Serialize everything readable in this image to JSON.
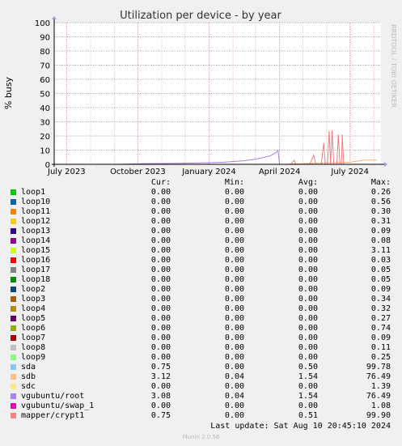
{
  "chart_data": {
    "type": "line",
    "title": "Utilization per device - by year",
    "ylabel": "% busy",
    "ylim": [
      0,
      100
    ],
    "yticks": [
      0,
      10,
      20,
      30,
      40,
      50,
      60,
      70,
      80,
      90,
      100
    ],
    "x_tick_labels": [
      "July 2023",
      "October 2023",
      "January 2024",
      "April 2024",
      "July 2024"
    ],
    "x_range": [
      "2023-06-15",
      "2024-08-10"
    ],
    "x_ticks": [
      "2023-07-01",
      "2023-10-01",
      "2024-01-01",
      "2024-04-01",
      "2024-07-01"
    ],
    "grid": true,
    "series": [
      {
        "name": "vgubuntu/root",
        "color": "#a680e6",
        "points": [
          [
            "2023-09-05",
            0
          ],
          [
            "2023-10-10",
            0.5
          ],
          [
            "2023-11-15",
            0.6
          ],
          [
            "2023-12-20",
            1.0
          ],
          [
            "2024-01-20",
            1.5
          ],
          [
            "2024-02-15",
            2.5
          ],
          [
            "2024-03-05",
            4.0
          ],
          [
            "2024-03-20",
            6.0
          ],
          [
            "2024-03-28",
            8.5
          ],
          [
            "2024-03-30",
            10.0
          ],
          [
            "2024-04-01",
            0
          ]
        ]
      },
      {
        "name": "sdb",
        "color": "#ffb077",
        "points": [
          [
            "2024-04-10",
            0
          ],
          [
            "2024-05-01",
            0.5
          ],
          [
            "2024-06-01",
            1.0
          ],
          [
            "2024-07-01",
            1.5
          ],
          [
            "2024-07-20",
            3.0
          ],
          [
            "2024-08-05",
            3.0
          ]
        ]
      },
      {
        "name": "mapper/crypt1",
        "color": "#f08080",
        "points": [
          [
            "2024-04-15",
            0
          ],
          [
            "2024-04-20",
            3.0
          ],
          [
            "2024-04-22",
            0
          ],
          [
            "2024-05-10",
            0
          ],
          [
            "2024-05-15",
            6.5
          ],
          [
            "2024-05-18",
            0
          ],
          [
            "2024-05-25",
            0
          ],
          [
            "2024-05-28",
            15
          ],
          [
            "2024-05-30",
            0
          ],
          [
            "2024-06-02",
            0
          ],
          [
            "2024-06-04",
            23.5
          ],
          [
            "2024-06-06",
            0
          ],
          [
            "2024-06-08",
            24
          ],
          [
            "2024-06-10",
            0
          ],
          [
            "2024-06-14",
            0
          ],
          [
            "2024-06-16",
            21
          ],
          [
            "2024-06-18",
            0
          ],
          [
            "2024-06-20",
            0
          ],
          [
            "2024-06-21",
            21
          ],
          [
            "2024-06-23",
            0
          ],
          [
            "2024-08-09",
            0
          ]
        ]
      }
    ]
  },
  "side_label": "RRDTOOL / TOBI OETIKER",
  "legend_headers": {
    "cur": "Cur:",
    "min": "Min:",
    "avg": "Avg:",
    "max": "Max:"
  },
  "legend": [
    {
      "name": "loop1",
      "color": "#00cc00",
      "cur": "0.00",
      "min": "0.00",
      "avg": "0.00",
      "max": "0.26"
    },
    {
      "name": "loop10",
      "color": "#0066b3",
      "cur": "0.00",
      "min": "0.00",
      "avg": "0.00",
      "max": "0.56"
    },
    {
      "name": "loop11",
      "color": "#ff8000",
      "cur": "0.00",
      "min": "0.00",
      "avg": "0.00",
      "max": "0.30"
    },
    {
      "name": "loop12",
      "color": "#ffcc00",
      "cur": "0.00",
      "min": "0.00",
      "avg": "0.00",
      "max": "0.31"
    },
    {
      "name": "loop13",
      "color": "#330099",
      "cur": "0.00",
      "min": "0.00",
      "avg": "0.00",
      "max": "0.09"
    },
    {
      "name": "loop14",
      "color": "#990099",
      "cur": "0.00",
      "min": "0.00",
      "avg": "0.00",
      "max": "0.08"
    },
    {
      "name": "loop15",
      "color": "#ccff00",
      "cur": "0.00",
      "min": "0.00",
      "avg": "0.00",
      "max": "3.11"
    },
    {
      "name": "loop16",
      "color": "#ff0000",
      "cur": "0.00",
      "min": "0.00",
      "avg": "0.00",
      "max": "0.03"
    },
    {
      "name": "loop17",
      "color": "#808080",
      "cur": "0.00",
      "min": "0.00",
      "avg": "0.00",
      "max": "0.05"
    },
    {
      "name": "loop18",
      "color": "#008f00",
      "cur": "0.00",
      "min": "0.00",
      "avg": "0.00",
      "max": "0.05"
    },
    {
      "name": "loop2",
      "color": "#00487d",
      "cur": "0.00",
      "min": "0.00",
      "avg": "0.00",
      "max": "0.09"
    },
    {
      "name": "loop3",
      "color": "#b35a00",
      "cur": "0.00",
      "min": "0.00",
      "avg": "0.00",
      "max": "0.34"
    },
    {
      "name": "loop4",
      "color": "#b38f00",
      "cur": "0.00",
      "min": "0.00",
      "avg": "0.00",
      "max": "0.32"
    },
    {
      "name": "loop5",
      "color": "#6b006b",
      "cur": "0.00",
      "min": "0.00",
      "avg": "0.00",
      "max": "0.27"
    },
    {
      "name": "loop6",
      "color": "#8fb300",
      "cur": "0.00",
      "min": "0.00",
      "avg": "0.00",
      "max": "0.74"
    },
    {
      "name": "loop7",
      "color": "#b30000",
      "cur": "0.00",
      "min": "0.00",
      "avg": "0.00",
      "max": "0.09"
    },
    {
      "name": "loop8",
      "color": "#bebebe",
      "cur": "0.00",
      "min": "0.00",
      "avg": "0.00",
      "max": "0.11"
    },
    {
      "name": "loop9",
      "color": "#80ff80",
      "cur": "0.00",
      "min": "0.00",
      "avg": "0.00",
      "max": "0.25"
    },
    {
      "name": "sda",
      "color": "#80c9ff",
      "cur": "0.75",
      "min": "0.00",
      "avg": "0.50",
      "max": "99.78"
    },
    {
      "name": "sdb",
      "color": "#ffc080",
      "cur": "3.12",
      "min": "0.04",
      "avg": "1.54",
      "max": "76.49"
    },
    {
      "name": "sdc",
      "color": "#ffe680",
      "cur": "0.00",
      "min": "0.00",
      "avg": "0.00",
      "max": "1.39"
    },
    {
      "name": "vgubuntu/root",
      "color": "#aa80ff",
      "cur": "3.08",
      "min": "0.04",
      "avg": "1.54",
      "max": "76.49"
    },
    {
      "name": "vgubuntu/swap_1",
      "color": "#ee00cc",
      "cur": "0.00",
      "min": "0.00",
      "avg": "0.00",
      "max": "1.08"
    },
    {
      "name": "mapper/crypt1",
      "color": "#ff8080",
      "cur": "0.75",
      "min": "0.00",
      "avg": "0.51",
      "max": "99.90"
    }
  ],
  "last_update": "Last update: Sat Aug 10 20:45:10 2024",
  "version": "Munin 2.0.56"
}
